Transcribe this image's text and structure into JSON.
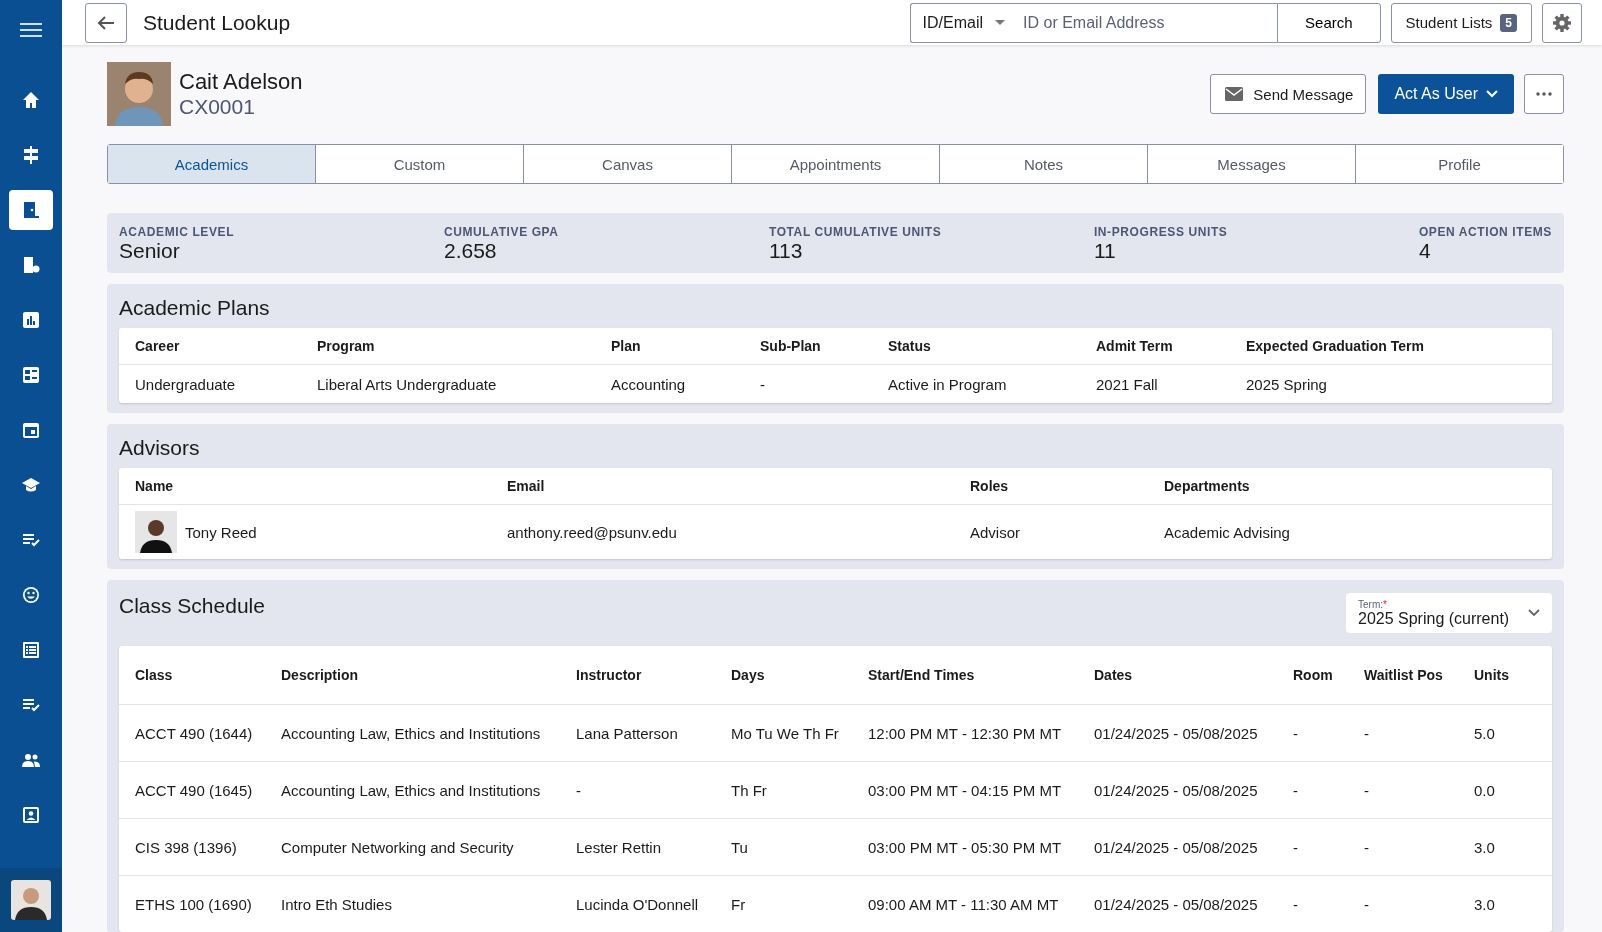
{
  "sidebar": {
    "items": [
      {
        "selected": false
      },
      {
        "selected": false
      },
      {
        "selected": true
      },
      {
        "selected": false
      },
      {
        "selected": false
      },
      {
        "selected": false
      },
      {
        "selected": false
      },
      {
        "selected": false
      },
      {
        "selected": false
      },
      {
        "selected": false
      },
      {
        "selected": false
      },
      {
        "selected": false
      },
      {
        "selected": false
      },
      {
        "selected": false
      }
    ]
  },
  "header": {
    "title": "Student Lookup",
    "search_type": "ID/Email",
    "search_placeholder": "ID or Email Address",
    "search_button": "Search",
    "lists_button": "Student Lists",
    "lists_count": "5"
  },
  "student": {
    "name": "Cait Adelson",
    "id": "CX0001",
    "send_message": "Send Message",
    "act_as_user": "Act As User"
  },
  "tabs": [
    {
      "label": "Academics",
      "selected": true
    },
    {
      "label": "Custom",
      "selected": false
    },
    {
      "label": "Canvas",
      "selected": false
    },
    {
      "label": "Appointments",
      "selected": false
    },
    {
      "label": "Notes",
      "selected": false
    },
    {
      "label": "Messages",
      "selected": false
    },
    {
      "label": "Profile",
      "selected": false
    }
  ],
  "summary": [
    {
      "label": "ACADEMIC LEVEL",
      "value": "Senior"
    },
    {
      "label": "CUMULATIVE GPA",
      "value": "2.658"
    },
    {
      "label": "TOTAL CUMULATIVE UNITS",
      "value": "113"
    },
    {
      "label": "IN-PROGRESS UNITS",
      "value": "11"
    },
    {
      "label": "OPEN ACTION ITEMS",
      "value": "4"
    }
  ],
  "academic_plans": {
    "title": "Academic Plans",
    "columns": [
      "Career",
      "Program",
      "Plan",
      "Sub-Plan",
      "Status",
      "Admit Term",
      "Expected Graduation Term"
    ],
    "rows": [
      [
        "Undergraduate",
        "Liberal Arts Undergraduate",
        "Accounting",
        "-",
        "Active in Program",
        "2021 Fall",
        "2025 Spring"
      ]
    ]
  },
  "advisors": {
    "title": "Advisors",
    "columns": [
      "Name",
      "Email",
      "Roles",
      "Departments"
    ],
    "rows": [
      {
        "name": "Tony Reed",
        "email": "anthony.reed@psunv.edu",
        "role": "Advisor",
        "department": "Academic Advising"
      }
    ]
  },
  "class_schedule": {
    "title": "Class Schedule",
    "term_label": "Term:",
    "required_mark": "*",
    "term_value": "2025 Spring (current)",
    "columns": [
      "Class",
      "Description",
      "Instructor",
      "Days",
      "Start/End Times",
      "Dates",
      "Room",
      "Waitlist Pos",
      "Units"
    ],
    "rows": [
      [
        "ACCT 490 (1644)",
        "Accounting Law, Ethics and Institutions",
        "Lana Patterson",
        "Mo Tu We Th Fr",
        "12:00 PM MT - 12:30 PM MT",
        "01/24/2025 - 05/08/2025",
        "-",
        "-",
        "5.0"
      ],
      [
        "ACCT 490 (1645)",
        "Accounting Law, Ethics and Institutions",
        "-",
        "Th Fr",
        "03:00 PM MT - 04:15 PM MT",
        "01/24/2025 - 05/08/2025",
        "-",
        "-",
        "0.0"
      ],
      [
        "CIS 398 (1396)",
        "Computer Networking and Security",
        "Lester Rettin",
        "Tu",
        "03:00 PM MT - 05:30 PM MT",
        "01/24/2025 - 05/08/2025",
        "-",
        "-",
        "3.0"
      ],
      [
        "ETHS 100 (1690)",
        "Intro Eth Studies",
        "Lucinda O'Donnell",
        "Fr",
        "09:00 AM MT - 11:30 AM MT",
        "01/24/2025 - 05/08/2025",
        "-",
        "-",
        "3.0"
      ]
    ]
  }
}
